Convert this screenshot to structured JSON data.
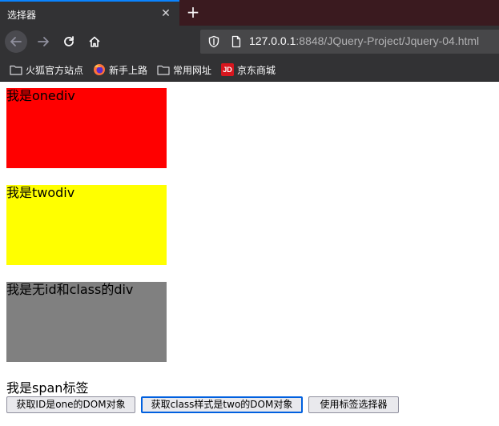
{
  "browser": {
    "tab_title": "选择器",
    "tab_close": "✕",
    "new_tab": "+",
    "url_host": "127.0.0.1",
    "url_rest": ":8848/JQuery-Project/Jquery-04.html",
    "bookmarks": [
      {
        "label": "火狐官方站点",
        "icon": "folder-icon"
      },
      {
        "label": "新手上路",
        "icon": "firefox-icon"
      },
      {
        "label": "常用网址",
        "icon": "folder-icon"
      },
      {
        "label": "京东商城",
        "icon": "jd-icon"
      }
    ],
    "jd_icon_text": "JD"
  },
  "page": {
    "div_one": {
      "text": "我是onediv",
      "color": "#ff0000"
    },
    "div_two": {
      "text": "我是twodiv",
      "color": "#ffff00"
    },
    "div_plain": {
      "text": "我是无id和class的div",
      "color": "#808080"
    },
    "span_text": "我是span标签",
    "buttons": [
      {
        "label": "获取ID是one的DOM对象"
      },
      {
        "label": "获取class样式是two的DOM对象"
      },
      {
        "label": "使用标签选择器"
      }
    ]
  },
  "theme": {
    "chrome_bg": "#323234",
    "tabstrip_bg": "#3a1a1f",
    "accent": "#0a84ff"
  }
}
